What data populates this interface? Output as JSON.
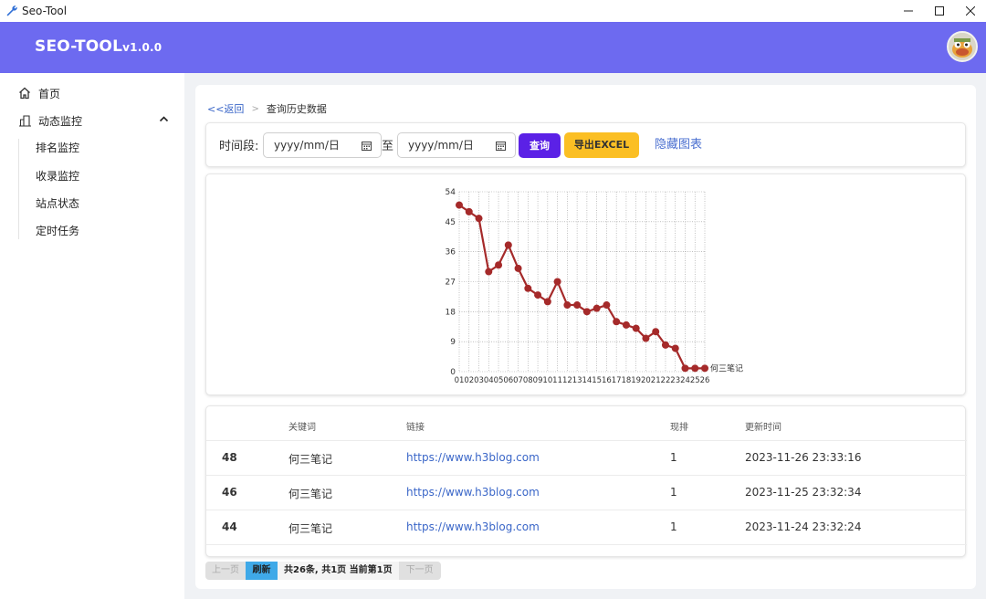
{
  "window": {
    "title": "Seo-Tool"
  },
  "header": {
    "brand": "SEO-TOOL",
    "version": "v1.0.0"
  },
  "sidebar": {
    "home": "首页",
    "monitor": "动态监控",
    "sub_items": [
      "排名监控",
      "收录监控",
      "站点状态",
      "定时任务"
    ]
  },
  "breadcrumb": {
    "back": "<<返回",
    "current": "查询历史数据"
  },
  "filter": {
    "label": "时间段:",
    "start_placeholder": "yyyy/mm/日",
    "to": "至",
    "end_placeholder": "yyyy/mm/日",
    "query": "查询",
    "export": "导出EXCEL",
    "hide_chart": "隐藏图表"
  },
  "chart_data": {
    "type": "line",
    "x": [
      "01",
      "02",
      "03",
      "04",
      "05",
      "06",
      "07",
      "08",
      "09",
      "10",
      "11",
      "12",
      "13",
      "14",
      "15",
      "16",
      "17",
      "18",
      "19",
      "20",
      "21",
      "22",
      "23",
      "24",
      "25",
      "26"
    ],
    "series": [
      {
        "name": "何三笔记",
        "color": "#a52a2a",
        "values": [
          50,
          48,
          46,
          30,
          32,
          38,
          31,
          25,
          23,
          21,
          27,
          20,
          20,
          18,
          19,
          20,
          15,
          14,
          13,
          10,
          12,
          8,
          7,
          1,
          1,
          1
        ]
      }
    ],
    "y_ticks": [
      "0",
      "9",
      "18",
      "27",
      "36",
      "45",
      "54"
    ],
    "ylim": [
      0,
      54
    ],
    "grid": true
  },
  "table": {
    "headers": [
      "关键词",
      "链接",
      "现排",
      "更新时间"
    ],
    "rows": [
      {
        "num": "48",
        "keyword": "何三笔记",
        "link": "https://www.h3blog.com",
        "rank": "1",
        "time": "2023-11-26 23:33:16"
      },
      {
        "num": "46",
        "keyword": "何三笔记",
        "link": "https://www.h3blog.com",
        "rank": "1",
        "time": "2023-11-25 23:32:34"
      },
      {
        "num": "44",
        "keyword": "何三笔记",
        "link": "https://www.h3blog.com",
        "rank": "1",
        "time": "2023-11-24 23:32:24"
      }
    ]
  },
  "pager": {
    "prev": "上一页",
    "refresh": "刷新",
    "info": "共26条, 共1页 当前第1页",
    "next": "下一页"
  }
}
